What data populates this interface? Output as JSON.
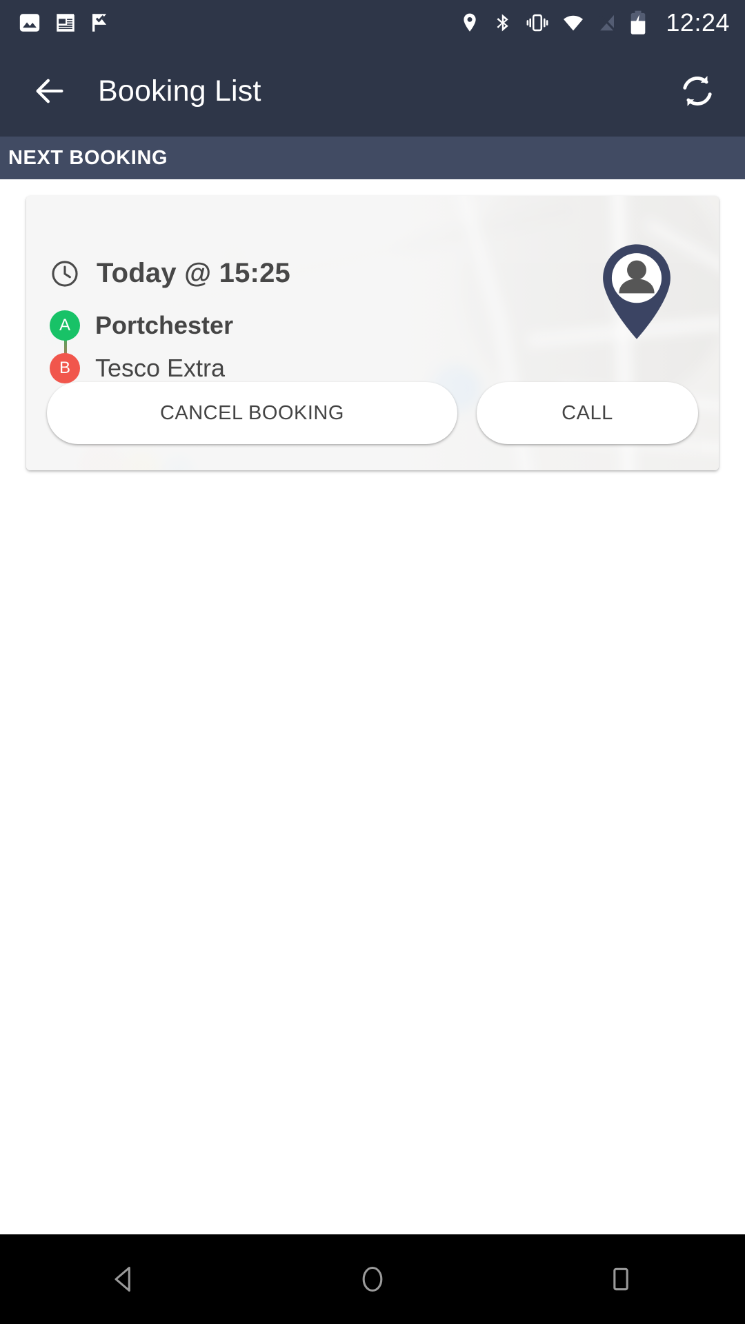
{
  "statusbar": {
    "left_icons": [
      "image-icon",
      "news-icon",
      "checkmark-flag-icon"
    ],
    "right_icons": [
      "location-pin-icon",
      "bluetooth-icon",
      "vibrate-icon",
      "wifi-icon",
      "signal-off-icon",
      "battery-charging-icon"
    ],
    "time": "12:24",
    "background": "#2e3648"
  },
  "appbar": {
    "back_label": "back-arrow",
    "title": "Booking List",
    "refresh_label": "refresh",
    "background": "#2e3648"
  },
  "section": {
    "title": "NEXT BOOKING",
    "background": "#414b63"
  },
  "booking": {
    "time": "Today @ 15:25",
    "pickup": {
      "marker": "A",
      "label": "Portchester",
      "color": "#18c267"
    },
    "dropoff": {
      "marker": "B",
      "label": "Tesco Extra",
      "color": "#f1564c"
    },
    "actions": {
      "cancel": "CANCEL BOOKING",
      "call": "CALL"
    },
    "map_marker": "passenger-avatar-pin",
    "marker_border_color": "#3b4463"
  },
  "navbar": {
    "back": "back-triangle-icon",
    "home": "home-circle-icon",
    "recents": "recents-square-icon",
    "background": "#000000"
  }
}
